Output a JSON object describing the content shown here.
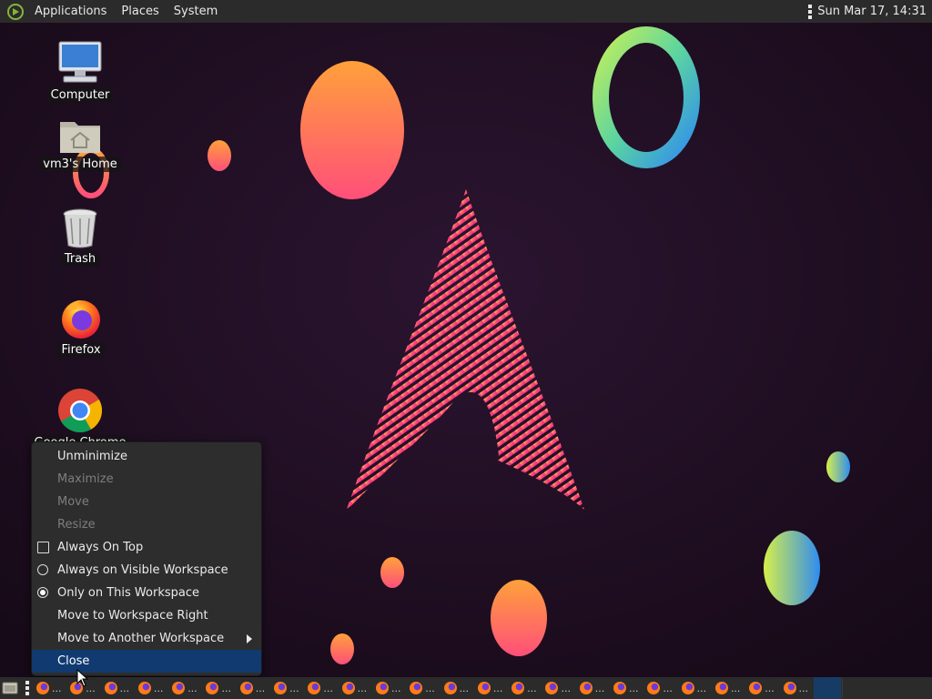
{
  "top_panel": {
    "menus": [
      "Applications",
      "Places",
      "System"
    ],
    "clock": "Sun Mar 17, 14:31"
  },
  "desktop": {
    "icons": [
      {
        "label": "Computer",
        "icon": "computer-icon"
      },
      {
        "label": "vm3's Home",
        "icon": "home-folder-icon"
      },
      {
        "label": "Trash",
        "icon": "trash-icon"
      },
      {
        "label": "Firefox",
        "icon": "firefox-icon"
      },
      {
        "label": "Google Chrome",
        "icon": "chrome-icon"
      }
    ]
  },
  "context_menu": {
    "items": [
      {
        "label": "Unminimize",
        "state": "enabled"
      },
      {
        "label": "Maximize",
        "state": "disabled"
      },
      {
        "label": "Move",
        "state": "disabled"
      },
      {
        "label": "Resize",
        "state": "disabled"
      },
      {
        "label": "Always On Top",
        "control": "checkbox",
        "checked": false
      },
      {
        "label": "Always on Visible Workspace",
        "control": "radio",
        "checked": false
      },
      {
        "label": "Only on This Workspace",
        "control": "radio",
        "checked": true
      },
      {
        "label": "Move to Workspace Right"
      },
      {
        "label": "Move to Another Workspace",
        "submenu": true
      },
      {
        "label": "Close",
        "highlighted": true
      }
    ]
  },
  "taskbar": {
    "window_buttons": 23,
    "button_icon": "firefox-icon",
    "truncated_label": "..."
  },
  "colors": {
    "panel_bg": "#2b2b2b",
    "menu_bg": "#2d2d2d",
    "menu_highlight": "#103a70",
    "wallpaper_bg": "#1c0d1c"
  }
}
